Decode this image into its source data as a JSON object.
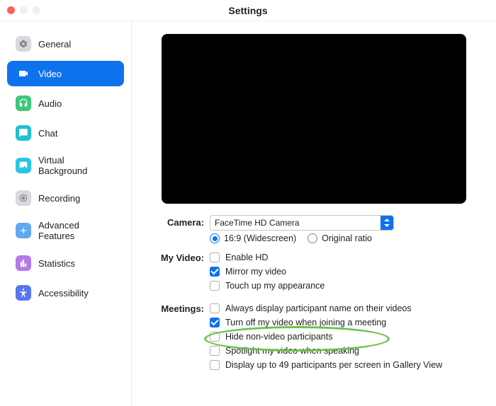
{
  "window": {
    "title": "Settings"
  },
  "sidebar": {
    "items": [
      {
        "label": "General",
        "icon": "gear-icon",
        "color": "#d7d9dc",
        "fg": "#888"
      },
      {
        "label": "Video",
        "icon": "video-icon",
        "color": "#ffffff00",
        "fg": "#fff"
      },
      {
        "label": "Audio",
        "icon": "headset-icon",
        "color": "#3ec77b",
        "fg": "#fff"
      },
      {
        "label": "Chat",
        "icon": "chat-icon",
        "color": "#1fc1d0",
        "fg": "#fff"
      },
      {
        "label": "Virtual Background",
        "icon": "vb-icon",
        "color": "#27c6e6",
        "fg": "#fff"
      },
      {
        "label": "Recording",
        "icon": "record-icon",
        "color": "#d7d9dc",
        "fg": "#888"
      },
      {
        "label": "Advanced Features",
        "icon": "plus-icon",
        "color": "#5ea8f4",
        "fg": "#fff"
      },
      {
        "label": "Statistics",
        "icon": "stats-icon",
        "color": "#b37be6",
        "fg": "#fff"
      },
      {
        "label": "Accessibility",
        "icon": "accessibility-icon",
        "color": "#5676f0",
        "fg": "#fff"
      }
    ],
    "activeIndex": 1
  },
  "main": {
    "camera": {
      "label": "Camera:",
      "selected": "FaceTime HD Camera",
      "ratio": {
        "widescreen": "16:9 (Widescreen)",
        "original": "Original ratio",
        "selected": "widescreen"
      }
    },
    "myvideo": {
      "label": "My Video:",
      "options": [
        {
          "label": "Enable HD",
          "checked": false
        },
        {
          "label": "Mirror my video",
          "checked": true
        },
        {
          "label": "Touch up my appearance",
          "checked": false
        }
      ]
    },
    "meetings": {
      "label": "Meetings:",
      "options": [
        {
          "label": "Always display participant name on their videos",
          "checked": false
        },
        {
          "label": "Turn off my video when joining a meeting",
          "checked": true
        },
        {
          "label": "Hide non-video participants",
          "checked": false
        },
        {
          "label": "Spotlight my video when speaking",
          "checked": false
        },
        {
          "label": "Display up to 49 participants per screen in Gallery View",
          "checked": false
        }
      ]
    }
  }
}
